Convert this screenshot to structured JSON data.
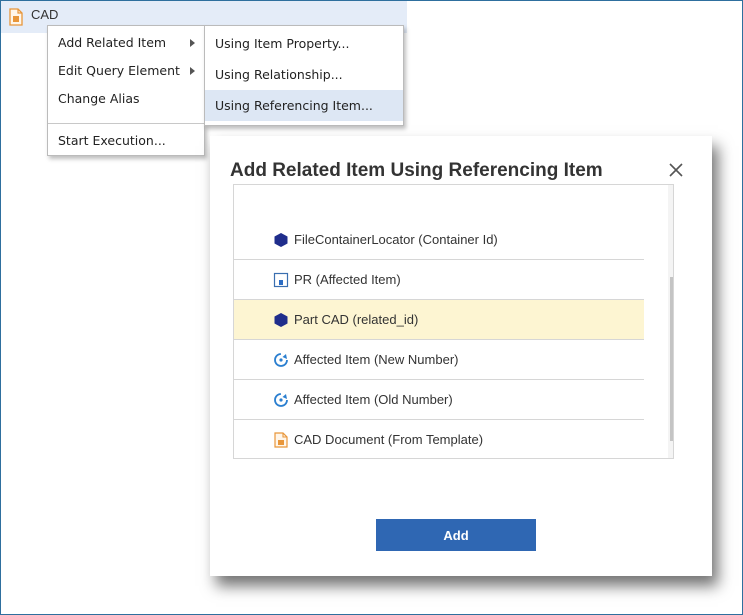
{
  "tree": {
    "item_label": "CAD"
  },
  "context_menu": {
    "items": [
      {
        "label": "Add Related Item",
        "has_submenu": true
      },
      {
        "label": "Edit Query Element",
        "has_submenu": true
      },
      {
        "label": "Change Alias",
        "has_submenu": false
      },
      {
        "label": "Start Execution...",
        "has_submenu": false
      }
    ]
  },
  "submenu": {
    "items": [
      {
        "label": "Using Item Property..."
      },
      {
        "label": "Using Relationship..."
      },
      {
        "label": "Using Referencing Item...",
        "active": true
      }
    ]
  },
  "dialog": {
    "title": "Add Related Item Using Referencing Item",
    "close_icon": "close-icon",
    "list": [
      {
        "label": "FileContainerLocator (Container Id)",
        "icon": "hexagon-icon"
      },
      {
        "label": "PR (Affected Item)",
        "icon": "document-lock-icon"
      },
      {
        "label": "Part CAD (related_id)",
        "icon": "hexagon-icon",
        "selected": true
      },
      {
        "label": "Affected Item (New Number)",
        "icon": "refresh-icon"
      },
      {
        "label": "Affected Item (Old Number)",
        "icon": "refresh-icon"
      },
      {
        "label": "CAD Document (From Template)",
        "icon": "cad-document-icon"
      }
    ],
    "add_label": "Add"
  },
  "colors": {
    "frame_border": "#2e6f9e",
    "selected_row": "#fdf5d2",
    "active_submenu": "#dde7f4",
    "button": "#2f67b3",
    "hexagon": "#1f2d8c",
    "refresh": "#2b7fd0",
    "cad_icon": "#e8963a"
  }
}
